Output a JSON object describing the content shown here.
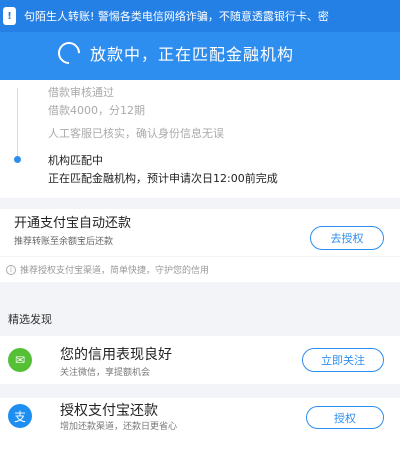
{
  "notice": {
    "badge": "!",
    "text": "句陌生人转账! 警惕各类电信网络诈骗，不随意透露银行卡、密"
  },
  "status": {
    "title": "放款中，正在匹配金融机构"
  },
  "timeline": [
    {
      "line1": "借款审核通过",
      "line2": "借款4000，分12期"
    },
    {
      "line1": "人工客服已核实，确认身份信息无误",
      "line2": ""
    },
    {
      "line1": "机构匹配中",
      "line2": "正在匹配金融机构，预计申请次日12:00前完成"
    }
  ],
  "autopay": {
    "title": "开通支付宝自动还款",
    "subtitle": "推荐转账至余额宝后还款",
    "button": "去授权"
  },
  "tip": {
    "icon": "i",
    "text": "推荐授权支付宝渠道，简单快捷，守护您的信用"
  },
  "section": {
    "title": "精选发现"
  },
  "features": [
    {
      "title": "您的信用表现良好",
      "subtitle": "关注微信，享提额机会",
      "button": "立即关注",
      "icon": "wechat-icon",
      "icon_glyph": "✉",
      "icon_color": "#55c035"
    },
    {
      "title": "授权支付宝还款",
      "subtitle": "增加还款渠道，还款日更省心",
      "button": "授权",
      "icon": "alipay-icon",
      "icon_glyph": "支",
      "icon_color": "#1e8ff0"
    }
  ],
  "colors": {
    "primary": "#2e8ef0",
    "header_dark": "#2580e6"
  }
}
